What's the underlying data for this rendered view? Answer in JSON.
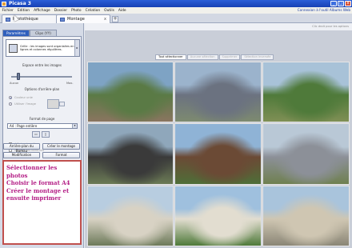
{
  "window": {
    "title": "Picasa 3",
    "controls": [
      "_",
      "□",
      "x"
    ]
  },
  "menu": {
    "items": [
      "Fichier",
      "Edition",
      "Affichage",
      "Dossier",
      "Photo",
      "Création",
      "Outils",
      "Aide"
    ],
    "account_link": "Connexion à l'outil Albums Web"
  },
  "tabs": {
    "library": "Photothèque",
    "collage": "Montage",
    "close_glyph": "x",
    "new_glyph": "+"
  },
  "left_panel": {
    "tabs": [
      "Paramètres",
      "Clips (YY)"
    ],
    "layout": {
      "description": "Grille : les images sont organisées en lignes et colonnes régulières."
    },
    "spacing_label": "Espace entre les images",
    "slider_min": "Aucun",
    "slider_max": "Max.",
    "background_options_label": "Options d'arrière-plan",
    "bg_radio_1": "Couleur unie",
    "bg_radio_2": "Utiliser l'image",
    "page_format_label": "Format de page",
    "page_format_value": "A4 : Page entière",
    "orientation_glyphs": [
      "▭",
      "▯"
    ],
    "checkbox_1": "Afficher la grille",
    "checkbox_2": "Afficher les bordures",
    "buttons": {
      "desktop": "Arrière-plan du Bureau",
      "create": "Créer le montage",
      "edit": "Modification",
      "format": "Format"
    },
    "instruction_lines": [
      "Sélectionner les photos",
      "Choisir le format A4",
      "Créer le montage et",
      "ensuite imprimer"
    ]
  },
  "canvas": {
    "hint": "Clic droit pour les options",
    "selection_buttons": [
      "Tout sélectionner",
      "Aucune sélection",
      "Supprimer",
      "Sélection inversée"
    ],
    "photos": [
      {
        "name": "photo-street-market",
        "colors": [
          "#7ea3c4",
          "#5a7a45",
          "#8a7560"
        ]
      },
      {
        "name": "photo-paris-panorama",
        "colors": [
          "#9bb3cc",
          "#6b7280",
          "#7d8a70"
        ]
      },
      {
        "name": "photo-park-lawn",
        "colors": [
          "#a8c2d8",
          "#4f7a3a",
          "#7f8f55"
        ]
      },
      {
        "name": "photo-bust-statue",
        "colors": [
          "#8fa7bb",
          "#3a3a3a",
          "#6b7a55"
        ]
      },
      {
        "name": "photo-windmill",
        "colors": [
          "#8fb3d6",
          "#6b4a35",
          "#4f6e38"
        ]
      },
      {
        "name": "photo-city-view",
        "colors": [
          "#b9c8d6",
          "#8c9098",
          "#6f8050"
        ]
      },
      {
        "name": "photo-sacre-coeur",
        "colors": [
          "#b8cde0",
          "#d8d2c4",
          "#6d7a5a"
        ]
      },
      {
        "name": "photo-sacre-coeur-far",
        "colors": [
          "#9fc0de",
          "#e2ddd0",
          "#4f7a3a"
        ]
      },
      {
        "name": "photo-assemblee",
        "colors": [
          "#a9c4dc",
          "#cfc6b2",
          "#8a8676"
        ]
      }
    ]
  }
}
